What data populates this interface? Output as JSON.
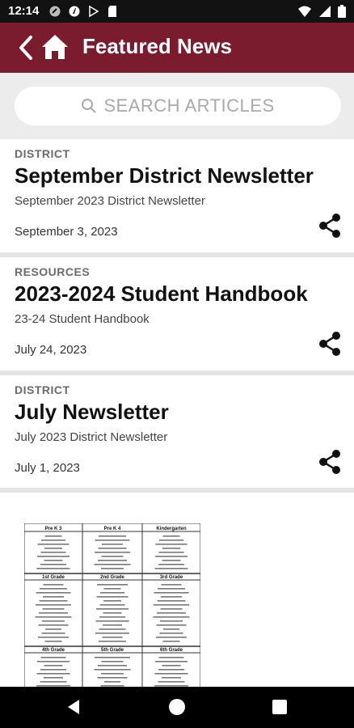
{
  "status_bar": {
    "time": "12:14"
  },
  "app_bar": {
    "title": "Featured News"
  },
  "search": {
    "placeholder": "SEARCH ARTICLES"
  },
  "articles": [
    {
      "category": "DISTRICT",
      "title": "September District Newsletter",
      "subtitle": "September 2023 District Newsletter",
      "date": "September 3, 2023"
    },
    {
      "category": "RESOURCES",
      "title": "2023-2024 Student Handbook",
      "subtitle": "23-24 Student Handbook",
      "date": "July 24, 2023"
    },
    {
      "category": "DISTRICT",
      "title": "July Newsletter",
      "subtitle": "July 2023 District Newsletter",
      "date": "July 1, 2023"
    }
  ],
  "supply_list": {
    "headers_row1": [
      "Pre K 3",
      "Pre K 4",
      "Kindergarten"
    ],
    "headers_row2": [
      "1st Grade",
      "2nd Grade",
      "3rd Grade"
    ],
    "headers_row3": [
      "4th Grade",
      "5th Grade",
      "6th Grade"
    ]
  },
  "colors": {
    "brand": "#7a1b2e",
    "search_bg": "#ececec"
  }
}
